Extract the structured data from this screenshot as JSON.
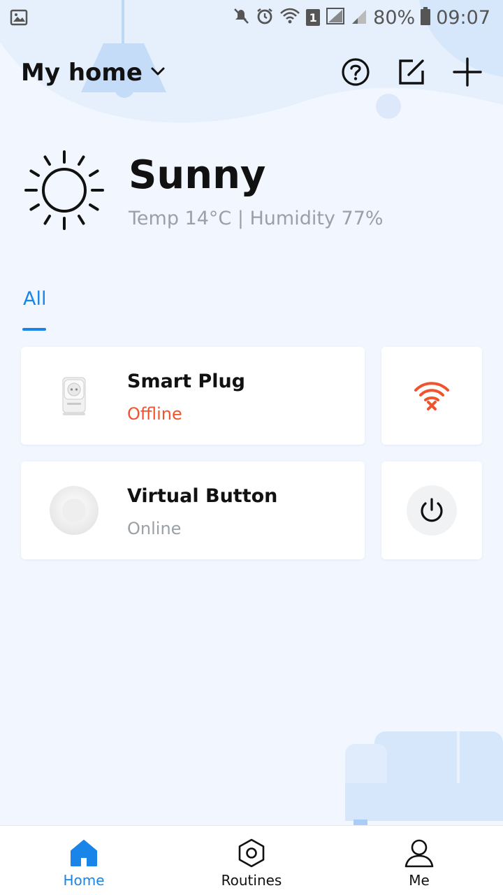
{
  "status_bar": {
    "battery": "80%",
    "time": "09:07",
    "sim_badge": "1"
  },
  "header": {
    "home_name": "My home",
    "icons": [
      "help-icon",
      "edit-icon",
      "add-icon"
    ]
  },
  "weather": {
    "condition": "Sunny",
    "details": "Temp 14°C | Humidity 77%",
    "icon": "sun-icon"
  },
  "tabs": [
    {
      "label": "All",
      "active": true
    }
  ],
  "devices": [
    {
      "name": "Smart Plug",
      "status": "Offline",
      "status_color": "#f0532d",
      "action_icon": "wifi-offline-icon"
    },
    {
      "name": "Virtual Button",
      "status": "Online",
      "status_color": "#9aa0a8",
      "action_icon": "power-icon"
    }
  ],
  "bottom_nav": [
    {
      "label": "Home",
      "icon": "home-icon",
      "active": true
    },
    {
      "label": "Routines",
      "icon": "routines-icon",
      "active": false
    },
    {
      "label": "Me",
      "icon": "user-icon",
      "active": false
    }
  ],
  "colors": {
    "accent": "#1a85e8",
    "offline": "#f0532d",
    "background": "#f2f7ff"
  }
}
